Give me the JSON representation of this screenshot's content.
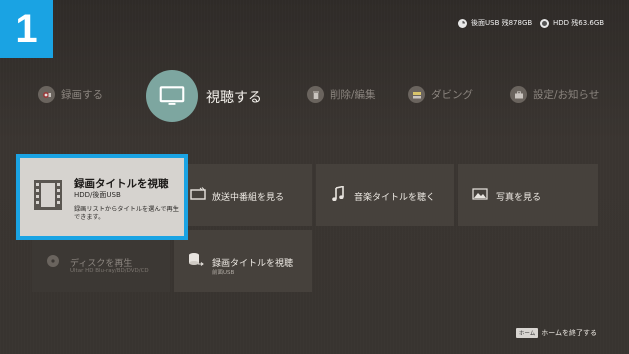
{
  "step": {
    "number": "1",
    "color": "#1aa3e3"
  },
  "storage": {
    "usb": {
      "icon": "pie-usage-icon",
      "text": "後面USB 残878GB"
    },
    "hdd": {
      "icon": "pie-usage-icon",
      "text": "HDD 残63.6GB"
    }
  },
  "top_menu": {
    "items": [
      {
        "label": "録画する",
        "icon": "record-icon"
      },
      {
        "label": "視聴する",
        "icon": "tv-icon",
        "active": true
      },
      {
        "label": "削除/編集",
        "icon": "trash-icon"
      },
      {
        "label": "ダビング",
        "icon": "dubbing-icon"
      },
      {
        "label": "設定/お知らせ",
        "icon": "toolbox-icon"
      }
    ]
  },
  "tiles": {
    "recorded_hdd": {
      "title": "録画タイトルを視聴",
      "sub": "HDD/後面USB",
      "desc": "録画リストからタイトルを選んで再生できます。",
      "icon": "film-icon"
    },
    "broadcast": {
      "title": "放送中番組を見る",
      "icon": "broadcast-tv-icon"
    },
    "music": {
      "title": "音楽タイトルを聴く",
      "icon": "music-note-icon"
    },
    "photo": {
      "title": "写真を見る",
      "icon": "photo-icon"
    },
    "disc": {
      "title": "ディスクを再生",
      "sub": "Ultar HD Blu-ray/BD/DVD/CD",
      "icon": "disc-icon"
    },
    "recorded_usb": {
      "title": "録画タイトルを視聴",
      "sub": "前面USB",
      "icon": "usb-storage-icon"
    }
  },
  "footer": {
    "key_label": "ホーム",
    "hint": "ホームを終了する"
  },
  "colors": {
    "accent": "#1aa3e3",
    "background": "#37332f",
    "active_menu": "#7da6a0"
  }
}
